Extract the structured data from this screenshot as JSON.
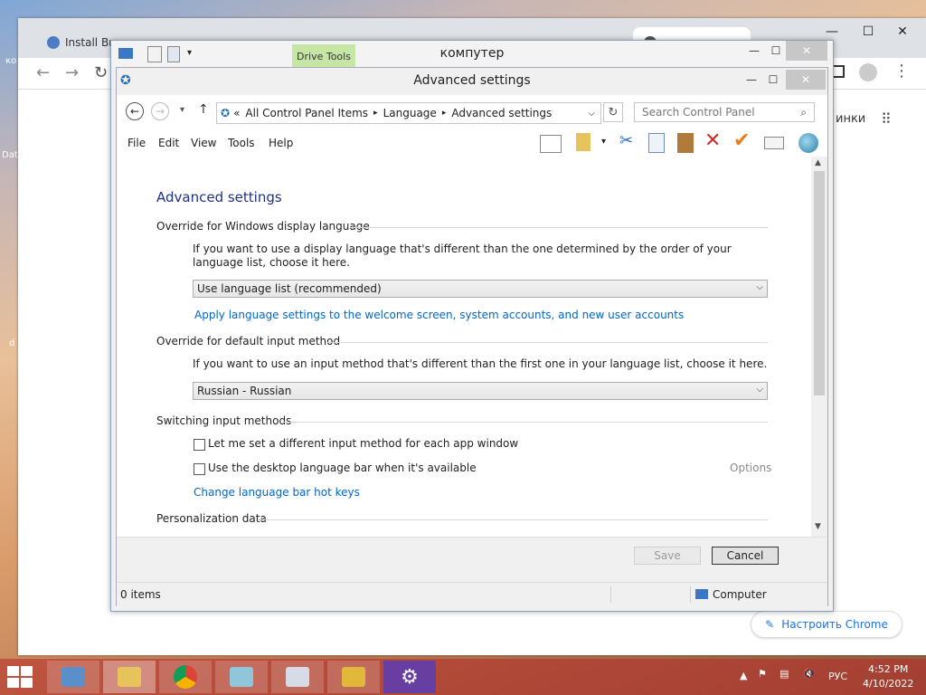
{
  "chrome": {
    "tabs": [
      "Install Bra",
      "",
      "",
      "",
      "",
      ""
    ],
    "right_text": "инки",
    "customize_label": "Настроить Chrome",
    "controls": {
      "min": "—",
      "max": "☐",
      "close": "✕"
    }
  },
  "desktop_icons": [
    "ко",
    "Dat",
    "d"
  ],
  "outer_window": {
    "title": "компутер",
    "drive_tools": "Drive Tools"
  },
  "window": {
    "title": "Advanced settings",
    "breadcrumb": [
      "All Control Panel Items",
      "Language",
      "Advanced settings"
    ],
    "breadcrumb_prefix": "«",
    "search_placeholder": "Search Control Panel",
    "menu": [
      "File",
      "Edit",
      "View",
      "Tools",
      "Help"
    ]
  },
  "content": {
    "heading": "Advanced settings",
    "display_lang": {
      "title": "Override for Windows display language",
      "desc": "If you want to use a display language that's different than the one determined by the order of your language list, choose it here.",
      "selected": "Use language list (recommended)",
      "link": "Apply language settings to the welcome screen, system accounts, and new user accounts"
    },
    "input_method": {
      "title": "Override for default input method",
      "desc": "If you want to use an input method that's different than the first one in your language list, choose it here.",
      "selected": "Russian - Russian"
    },
    "switching": {
      "title": "Switching input methods",
      "cb1": "Let me set a different input method for each app window",
      "cb2": "Use the desktop language bar when it's available",
      "options": "Options",
      "link": "Change language bar hot keys"
    },
    "personalization": {
      "title": "Personalization data"
    }
  },
  "footer": {
    "save": "Save",
    "cancel": "Cancel"
  },
  "status": {
    "items": "0 items",
    "computer": "Computer"
  },
  "taskbar": {
    "lang": "РУС",
    "time": "4:52 PM",
    "date": "4/10/2022"
  }
}
